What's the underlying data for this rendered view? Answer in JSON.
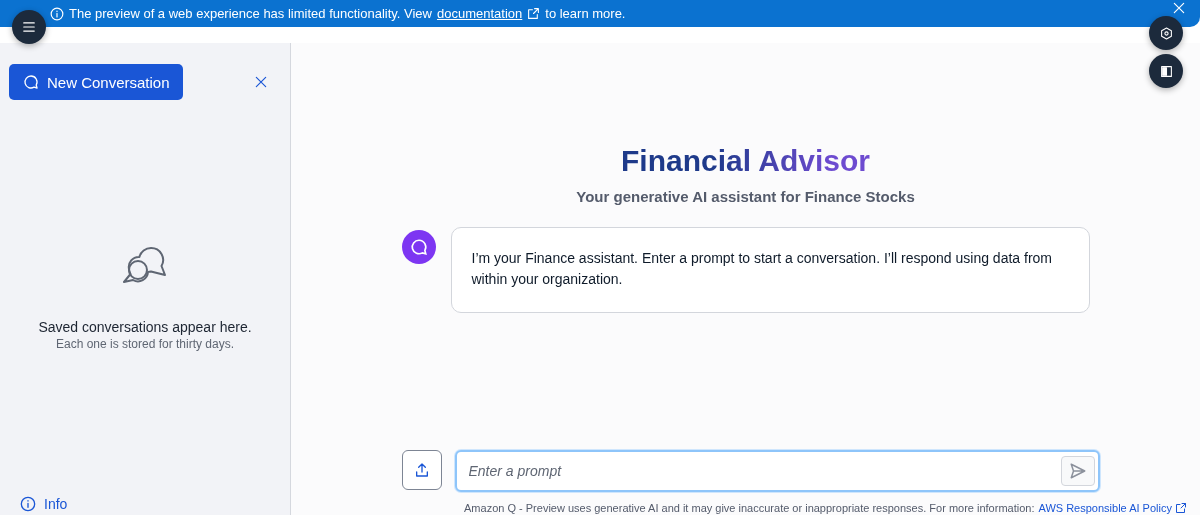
{
  "banner": {
    "text_before": "The preview of a web experience has limited functionality. View",
    "link": "documentation",
    "text_after": "to learn more."
  },
  "sidebar": {
    "new_button": "New Conversation",
    "empty_title": "Saved conversations appear here.",
    "empty_subtitle": "Each one is stored for thirty days.",
    "info_link": "Info"
  },
  "header": {
    "title": "Financial Advisor",
    "subtitle": "Your generative AI assistant for Finance Stocks"
  },
  "messages": [
    {
      "kind": "assistant",
      "text": "I’m your Finance assistant. Enter a prompt to start a conversation. I’ll respond using data from within your organization."
    }
  ],
  "prompt": {
    "placeholder": "Enter a prompt"
  },
  "footer": {
    "text": "Amazon Q - Preview uses generative AI and it may give inaccurate or inappropriate responses. For more information:",
    "link": "AWS Responsible AI Policy"
  }
}
